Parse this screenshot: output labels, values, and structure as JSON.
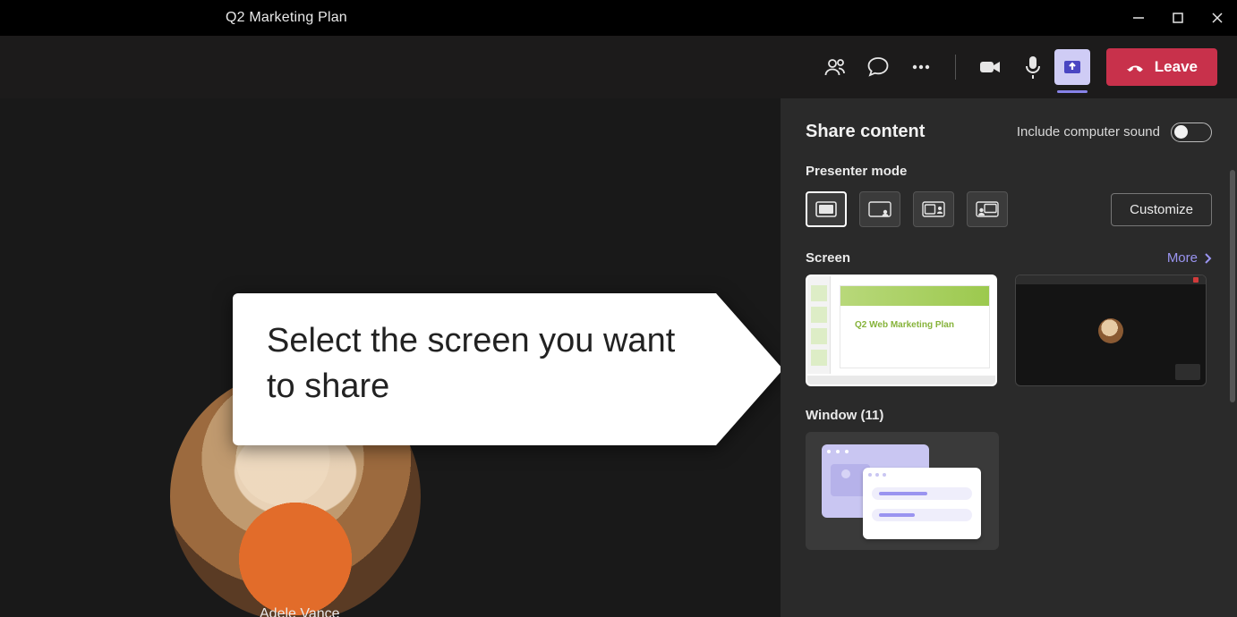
{
  "titlebar": {
    "title": "Q2 Marketing Plan"
  },
  "toolbar": {
    "leave_label": "Leave"
  },
  "participant": {
    "name": "Adele Vance"
  },
  "callout": {
    "text": "Select the screen you want to share"
  },
  "share_panel": {
    "title": "Share content",
    "include_sound_label": "Include computer sound",
    "presenter_mode_label": "Presenter mode",
    "customize_label": "Customize",
    "screen_label": "Screen",
    "more_label": "More",
    "window_label": "Window (11)",
    "screen1_slide_title": "Q2 Web Marketing Plan"
  }
}
